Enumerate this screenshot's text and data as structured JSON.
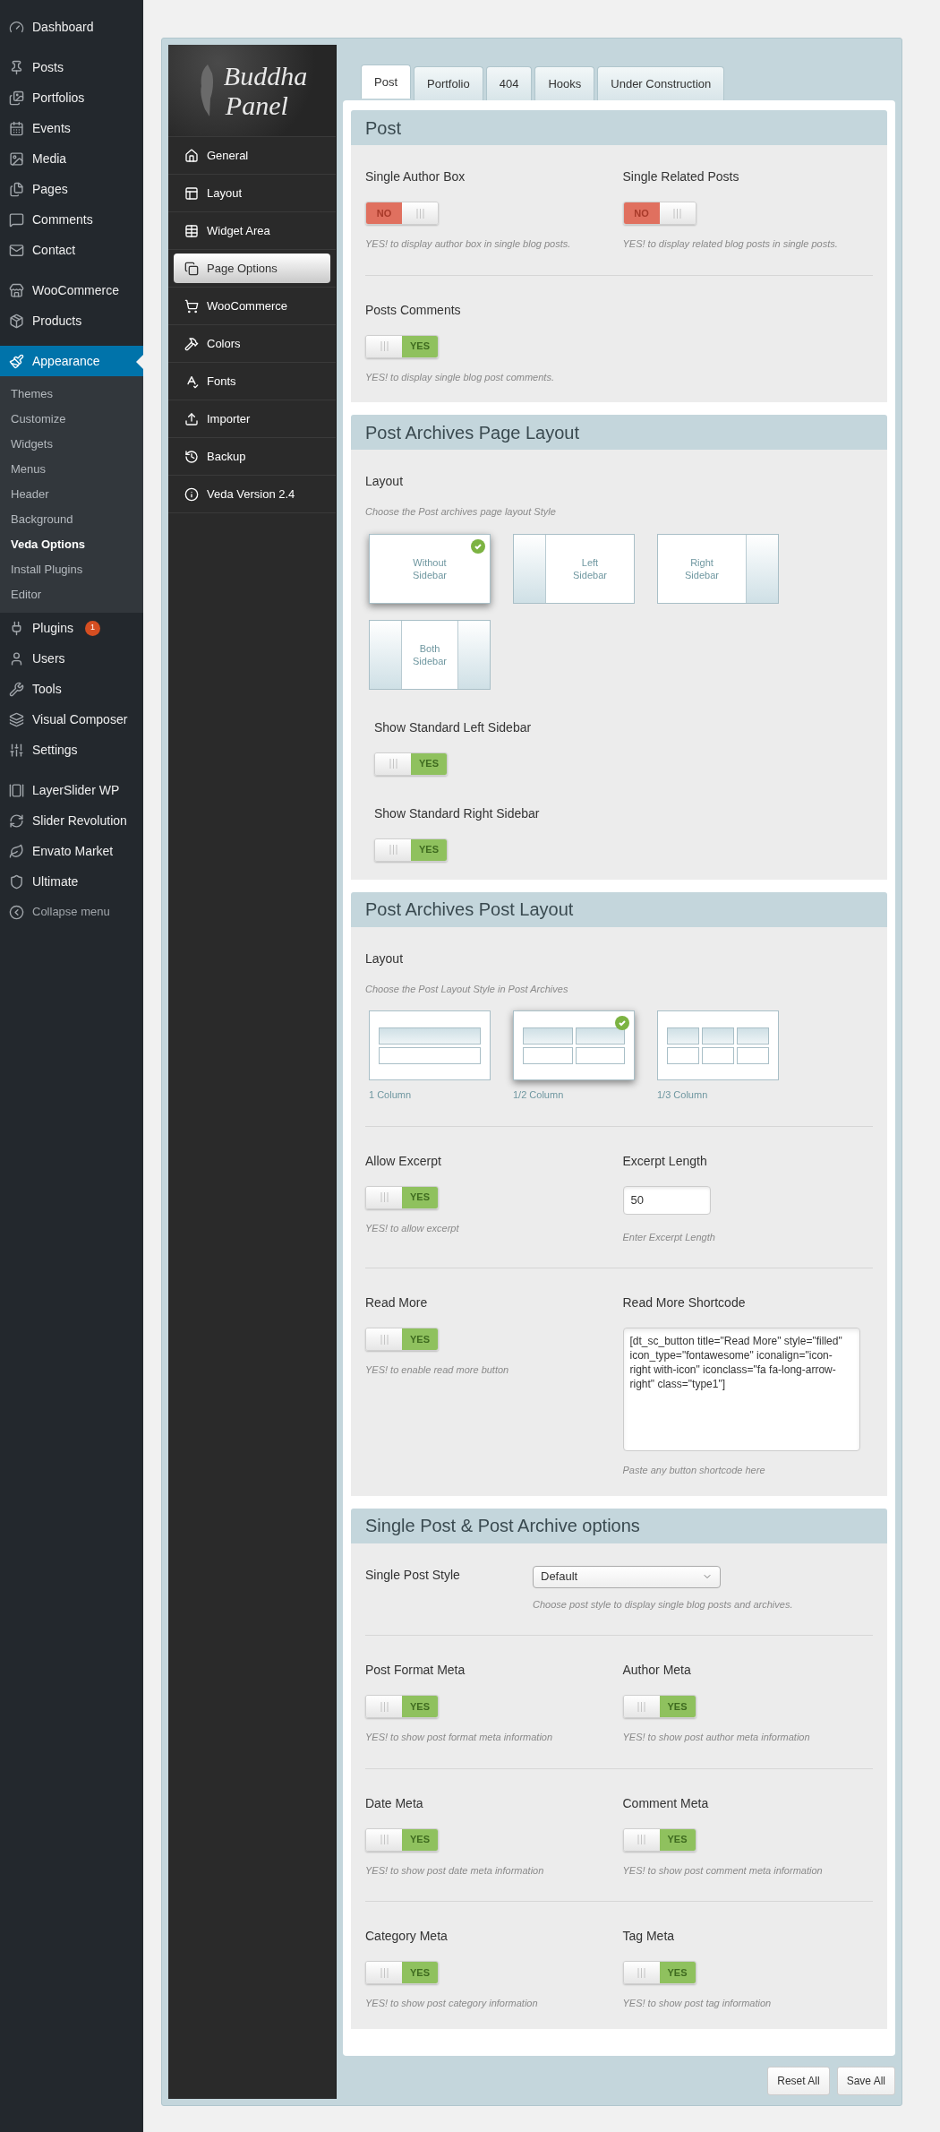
{
  "admin_menu": {
    "groups": [
      {
        "items": [
          {
            "label": "Dashboard",
            "selected": false
          }
        ]
      },
      {
        "items": [
          {
            "label": "Posts",
            "selected": false
          },
          {
            "label": "Portfolios",
            "selected": false
          },
          {
            "label": "Events",
            "selected": false
          },
          {
            "label": "Media",
            "selected": false
          },
          {
            "label": "Pages",
            "selected": false
          },
          {
            "label": "Comments",
            "selected": false
          },
          {
            "label": "Contact",
            "selected": false
          }
        ]
      },
      {
        "items": [
          {
            "label": "WooCommerce",
            "selected": false
          },
          {
            "label": "Products",
            "selected": false
          }
        ]
      },
      {
        "items": [
          {
            "label": "Appearance",
            "selected": true,
            "children": [
              {
                "label": "Themes",
                "selected": false
              },
              {
                "label": "Customize",
                "selected": false
              },
              {
                "label": "Widgets",
                "selected": false
              },
              {
                "label": "Menus",
                "selected": false
              },
              {
                "label": "Header",
                "selected": false
              },
              {
                "label": "Background",
                "selected": false
              },
              {
                "label": "Veda Options",
                "selected": true
              },
              {
                "label": "Install Plugins",
                "selected": false
              },
              {
                "label": "Editor",
                "selected": false
              }
            ]
          },
          {
            "label": "Plugins",
            "selected": false,
            "badge": "1"
          },
          {
            "label": "Users",
            "selected": false
          },
          {
            "label": "Tools",
            "selected": false
          },
          {
            "label": "Visual Composer",
            "selected": false
          },
          {
            "label": "Settings",
            "selected": false
          }
        ]
      },
      {
        "items": [
          {
            "label": "LayerSlider WP",
            "selected": false
          },
          {
            "label": "Slider Revolution",
            "selected": false
          },
          {
            "label": "Envato Market",
            "selected": false
          },
          {
            "label": "Ultimate",
            "selected": false
          }
        ]
      }
    ],
    "collapse_label": "Collapse menu"
  },
  "panel": {
    "logo": [
      "Buddha",
      "Panel"
    ],
    "nav": [
      {
        "label": "General",
        "selected": false
      },
      {
        "label": "Layout",
        "selected": false
      },
      {
        "label": "Widget Area",
        "selected": false
      },
      {
        "label": "Page Options",
        "selected": true
      },
      {
        "label": "WooCommerce",
        "selected": false
      },
      {
        "label": "Colors",
        "selected": false
      },
      {
        "label": "Fonts",
        "selected": false
      },
      {
        "label": "Importer",
        "selected": false
      },
      {
        "label": "Backup",
        "selected": false
      },
      {
        "label": "Veda Version 2.4",
        "selected": false
      }
    ]
  },
  "tabs": [
    {
      "label": "Post",
      "selected": true
    },
    {
      "label": "Portfolio",
      "selected": false
    },
    {
      "label": "404",
      "selected": false
    },
    {
      "label": "Hooks",
      "selected": false
    },
    {
      "label": "Under Construction",
      "selected": false
    }
  ],
  "sections": [
    {
      "title": "Post",
      "rows": [
        [
          {
            "kind": "toggle",
            "label": "Single Author Box",
            "on": false,
            "state_text": "NO",
            "hint": "YES! to display author box in single blog posts."
          },
          {
            "kind": "toggle",
            "label": "Single Related Posts",
            "on": false,
            "state_text": "NO",
            "hint": "YES! to display related blog posts in single posts."
          }
        ],
        [
          {
            "kind": "toggle",
            "label": "Posts Comments",
            "on": true,
            "state_text": "YES",
            "hint": "YES! to display single blog post comments."
          }
        ]
      ]
    },
    {
      "title": "Post Archives Page Layout",
      "rows": [
        [
          {
            "kind": "layout_picker",
            "label": "Layout",
            "hint": "Choose the Post archives page layout Style",
            "options": [
              {
                "kind": "no_sidebar",
                "label": "Without Sidebar",
                "selected": true
              },
              {
                "kind": "left_sidebar",
                "label": "Left Sidebar",
                "selected": false
              },
              {
                "kind": "right_sidebar",
                "label": "Right Sidebar",
                "selected": false
              },
              {
                "kind": "both_sidebar",
                "label": "Both Sidebar",
                "selected": false
              }
            ]
          }
        ],
        [
          {
            "kind": "toggle",
            "label": "Show Standard Left Sidebar",
            "on": true,
            "state_text": "YES"
          }
        ],
        [
          {
            "kind": "toggle",
            "label": "Show Standard Right Sidebar",
            "on": true,
            "state_text": "YES"
          }
        ]
      ]
    },
    {
      "title": "Post Archives Post Layout",
      "rows": [
        [
          {
            "kind": "column_picker",
            "label": "Layout",
            "hint": "Choose the Post Layout Style in Post Archives",
            "options": [
              {
                "kind": "one_column",
                "label": "1 Column",
                "selected": false
              },
              {
                "kind": "half_column",
                "label": "1/2 Column",
                "selected": true
              },
              {
                "kind": "third_column",
                "label": "1/3 Column",
                "selected": false
              }
            ]
          }
        ],
        [
          {
            "kind": "toggle",
            "label": "Allow Excerpt",
            "on": true,
            "state_text": "YES",
            "hint": "YES! to allow excerpt"
          },
          {
            "kind": "text_input",
            "label": "Excerpt Length",
            "value": "50",
            "hint": "Enter Excerpt Length"
          }
        ],
        [
          {
            "kind": "toggle",
            "label": "Read More",
            "on": true,
            "state_text": "YES",
            "hint": "YES! to enable read more button"
          },
          {
            "kind": "textarea",
            "label": "Read More Shortcode",
            "value": "[dt_sc_button title=\"Read More\" style=\"filled\" icon_type=\"fontawesome\" iconalign=\"icon-right with-icon\" iconclass=\"fa fa-long-arrow-right\" class=\"type1\"]",
            "hint": "Paste any button shortcode here"
          }
        ]
      ]
    },
    {
      "title": "Single Post & Post Archive options",
      "rows": [
        [
          {
            "kind": "select",
            "label": "Single Post Style",
            "value": "Default",
            "hint": "Choose post style to display single blog posts and archives."
          }
        ],
        [
          {
            "kind": "toggle",
            "label": "Post Format Meta",
            "on": true,
            "state_text": "YES",
            "hint": "YES! to show post format meta information"
          },
          {
            "kind": "toggle",
            "label": "Author Meta",
            "on": true,
            "state_text": "YES",
            "hint": "YES! to show post author meta information"
          }
        ],
        [
          {
            "kind": "toggle",
            "label": "Date Meta",
            "on": true,
            "state_text": "YES",
            "hint": "YES! to show post date meta information"
          },
          {
            "kind": "toggle",
            "label": "Comment Meta",
            "on": true,
            "state_text": "YES",
            "hint": "YES! to show post comment meta information"
          }
        ],
        [
          {
            "kind": "toggle",
            "label": "Category Meta",
            "on": true,
            "state_text": "YES",
            "hint": "YES! to show post category information"
          },
          {
            "kind": "toggle",
            "label": "Tag Meta",
            "on": true,
            "state_text": "YES",
            "hint": "YES! to show post tag information"
          }
        ]
      ]
    }
  ],
  "buttons": [
    "Reset All",
    "Save All"
  ]
}
